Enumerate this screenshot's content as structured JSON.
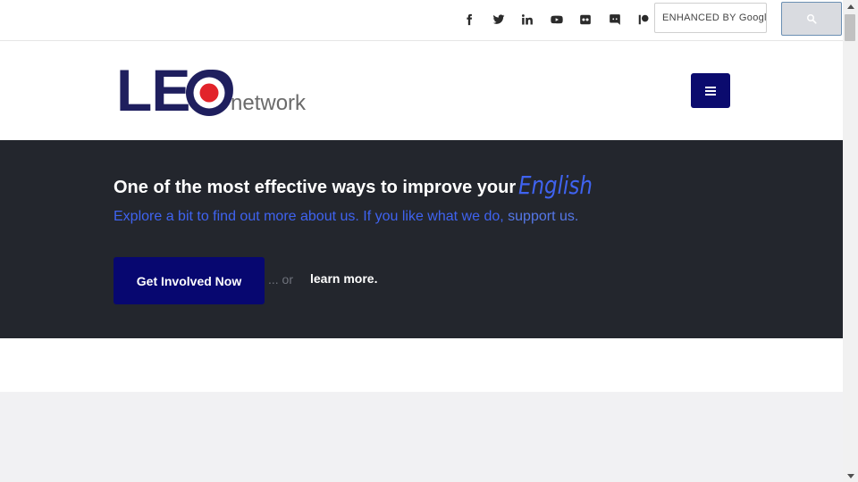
{
  "topbar": {
    "social_icons": [
      "facebook-icon",
      "twitter-icon",
      "linkedin-icon",
      "youtube-icon",
      "flickr-icon",
      "discord-icon",
      "patreon-icon"
    ],
    "search_placeholder": "ENHANCED BY Google",
    "search_button_icon": "search-icon"
  },
  "header": {
    "logo_main": "LEO",
    "logo_sub": "network",
    "menu_icon": "hamburger-icon",
    "colors": {
      "logo_navy": "#1f1f5e",
      "logo_red": "#e2232a",
      "menu_bg": "#0b0b6e"
    }
  },
  "hero": {
    "title": "One of the most effective ways to improve your",
    "title_accent": "English",
    "subtitle": "Explore a bit to find out more about us. If you like what we do,",
    "subtitle_link": "support us.",
    "cta_label": "Get Involved Now",
    "or_text": "... or",
    "learn_more": "learn more.",
    "colors": {
      "background": "#23262d",
      "accent": "#3f63f0",
      "cta_bg": "#070770"
    }
  }
}
